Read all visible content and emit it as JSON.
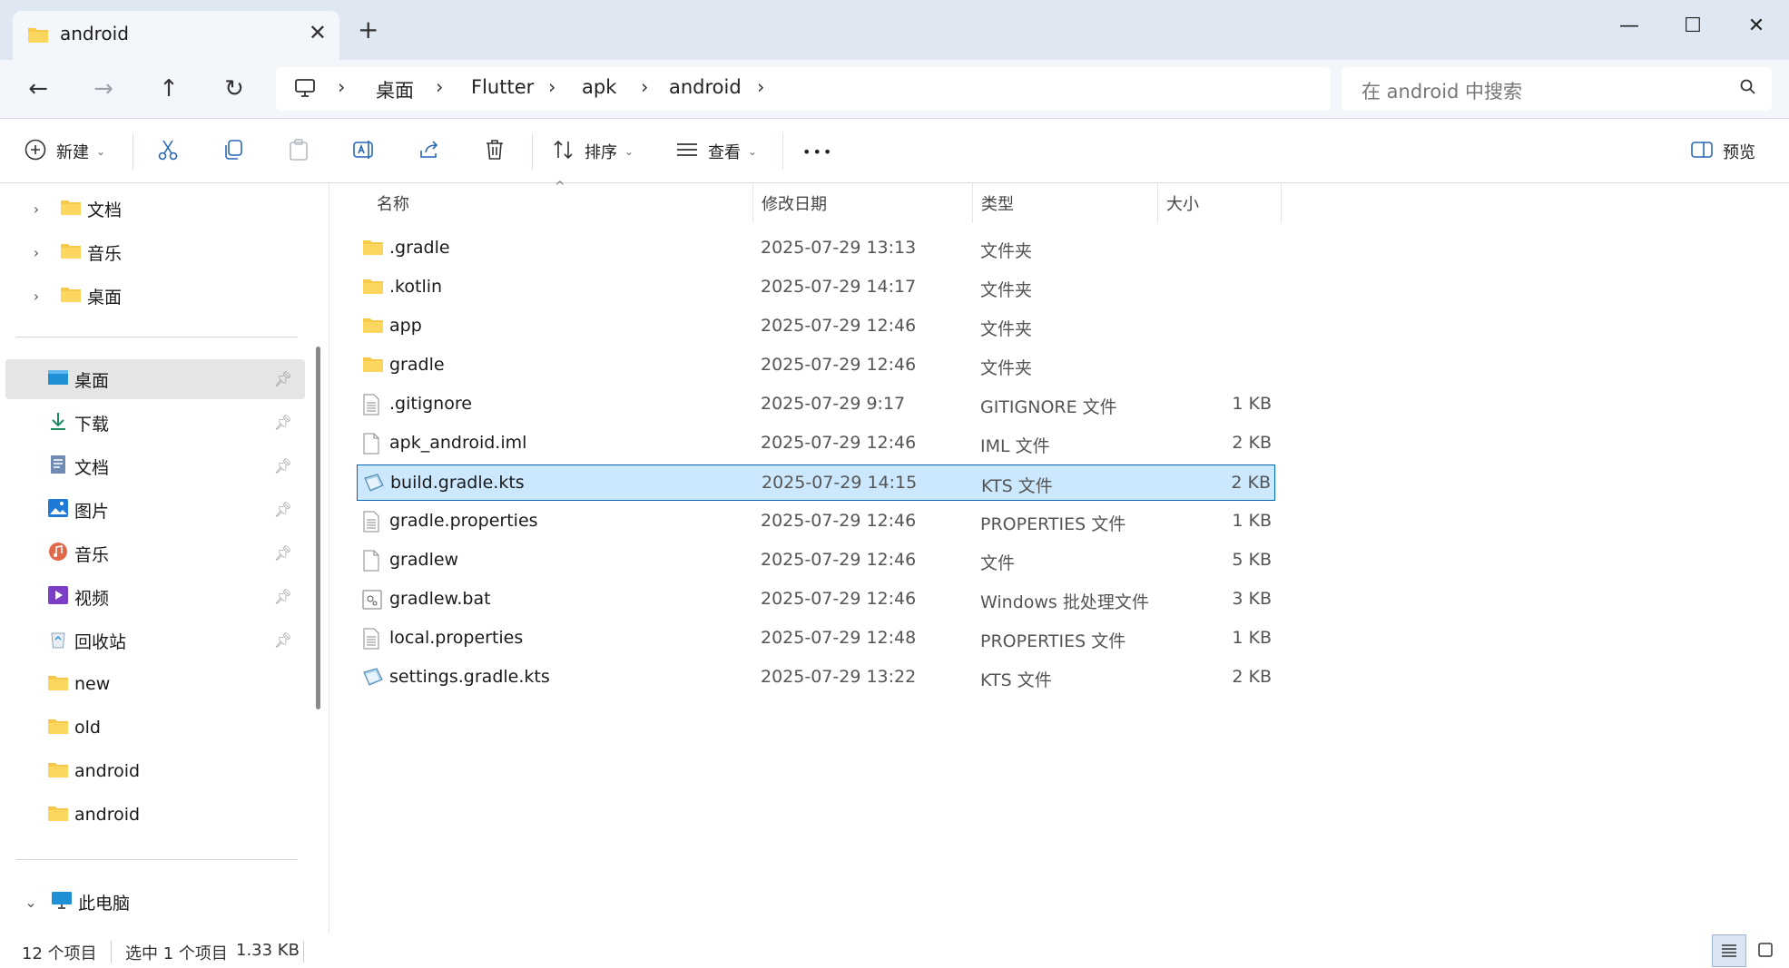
{
  "window": {
    "tab_title": "android",
    "new_tab": "+",
    "minimize": "—",
    "maximize": "☐",
    "close": "✕"
  },
  "nav": {
    "back": "←",
    "forward": "→",
    "up": "↑",
    "refresh": "↻",
    "breadcrumbs": [
      "桌面",
      "Flutter",
      "apk",
      "android"
    ],
    "search_placeholder": "在 android 中搜索"
  },
  "toolbar": {
    "new_label": "新建",
    "sort_label": "排序",
    "view_label": "查看",
    "more": "•••",
    "preview_label": "预览"
  },
  "sidebar": {
    "tree_items": [
      {
        "label": "文档"
      },
      {
        "label": "音乐"
      },
      {
        "label": "桌面"
      }
    ],
    "quick_access": [
      {
        "label": "桌面",
        "icon": "desktop-icon",
        "pinned": true,
        "active": true
      },
      {
        "label": "下载",
        "icon": "download-icon",
        "pinned": true
      },
      {
        "label": "文档",
        "icon": "document-icon",
        "pinned": true
      },
      {
        "label": "图片",
        "icon": "pictures-icon",
        "pinned": true
      },
      {
        "label": "音乐",
        "icon": "music-icon",
        "pinned": true
      },
      {
        "label": "视频",
        "icon": "video-icon",
        "pinned": true
      },
      {
        "label": "回收站",
        "icon": "recycle-bin-icon",
        "pinned": true
      },
      {
        "label": "new",
        "icon": "folder-icon",
        "pinned": false
      },
      {
        "label": "old",
        "icon": "folder-icon",
        "pinned": false
      },
      {
        "label": "android",
        "icon": "folder-icon",
        "pinned": false
      },
      {
        "label": "android",
        "icon": "folder-icon",
        "pinned": false
      }
    ],
    "this_pc": "此电脑"
  },
  "columns": {
    "name": "名称",
    "date": "修改日期",
    "type": "类型",
    "size": "大小"
  },
  "files": [
    {
      "name": ".gradle",
      "date": "2025-07-29 13:13",
      "type": "文件夹",
      "size": "",
      "icon": "folder-icon"
    },
    {
      "name": ".kotlin",
      "date": "2025-07-29 14:17",
      "type": "文件夹",
      "size": "",
      "icon": "folder-icon"
    },
    {
      "name": "app",
      "date": "2025-07-29 12:46",
      "type": "文件夹",
      "size": "",
      "icon": "folder-icon"
    },
    {
      "name": "gradle",
      "date": "2025-07-29 12:46",
      "type": "文件夹",
      "size": "",
      "icon": "folder-icon"
    },
    {
      "name": ".gitignore",
      "date": "2025-07-29 9:17",
      "type": "GITIGNORE 文件",
      "size": "1 KB",
      "icon": "text-file-icon"
    },
    {
      "name": "apk_android.iml",
      "date": "2025-07-29 12:46",
      "type": "IML 文件",
      "size": "2 KB",
      "icon": "blank-file-icon"
    },
    {
      "name": "build.gradle.kts",
      "date": "2025-07-29 14:15",
      "type": "KTS 文件",
      "size": "2 KB",
      "icon": "kts-file-icon",
      "selected": true
    },
    {
      "name": "gradle.properties",
      "date": "2025-07-29 12:46",
      "type": "PROPERTIES 文件",
      "size": "1 KB",
      "icon": "text-file-icon"
    },
    {
      "name": "gradlew",
      "date": "2025-07-29 12:46",
      "type": "文件",
      "size": "5 KB",
      "icon": "blank-file-icon"
    },
    {
      "name": "gradlew.bat",
      "date": "2025-07-29 12:46",
      "type": "Windows 批处理文件",
      "size": "3 KB",
      "icon": "batch-file-icon"
    },
    {
      "name": "local.properties",
      "date": "2025-07-29 12:48",
      "type": "PROPERTIES 文件",
      "size": "1 KB",
      "icon": "text-file-icon"
    },
    {
      "name": "settings.gradle.kts",
      "date": "2025-07-29 13:22",
      "type": "KTS 文件",
      "size": "2 KB",
      "icon": "kts-file-icon"
    }
  ],
  "status": {
    "item_count": "12 个项目",
    "selection": "选中 1 个项目",
    "selection_size": "1.33 KB"
  },
  "colors": {
    "titlebar": "#dfe8f2",
    "navbar": "#f3f6fa",
    "selection_fill": "#cce8ff",
    "selection_border": "#0067c0",
    "folder": "#f7c948"
  }
}
